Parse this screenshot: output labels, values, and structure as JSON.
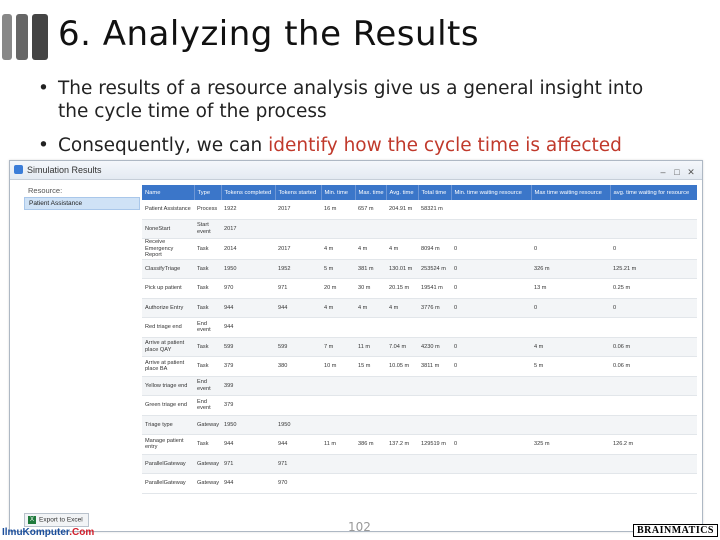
{
  "slide": {
    "title": "6. Analyzing the Results",
    "bullets": [
      {
        "text": "The results of a resource analysis give us a general insight into the cycle time of the process"
      },
      {
        "text_before": "Consequently, we can ",
        "highlight": "identify how the cycle time is affected"
      }
    ],
    "page_number": "102",
    "logo_left": {
      "part1": "IlmuKomputer",
      "part2": ".Com"
    },
    "logo_right": "BRAINMATICS",
    "highlight_color": "#c0392b",
    "title_bar_color": "#555555"
  },
  "window": {
    "title": "Simulation Results",
    "buttons": {
      "minimize": "–",
      "maximize": "□",
      "close": "✕"
    },
    "sidebar": {
      "label": "Resource:",
      "items": [
        "Patient Assistance"
      ]
    },
    "export_button": "Export to Excel",
    "header_color": "#3b76c9",
    "table": {
      "headers": [
        "Name",
        "Type",
        "Tokens completed",
        "Tokens started",
        "Min. time",
        "Max. time",
        "Avg. time",
        "Total time",
        "Min. time waiting resource",
        "Max time waiting resource",
        "avg. time waiting for resource"
      ],
      "rows": [
        [
          "Patient Assistance",
          "Process",
          "1922",
          "2017",
          "16 m",
          "657 m",
          "204.91 m",
          "58321 m",
          "",
          "",
          ""
        ],
        [
          "NoneStart",
          "Start event",
          "2017",
          "",
          "",
          "",
          "",
          "",
          "",
          "",
          ""
        ],
        [
          "Receive Emergency Report",
          "Task",
          "2014",
          "2017",
          "4 m",
          "4 m",
          "4 m",
          "8094 m",
          "0",
          "0",
          "0"
        ],
        [
          "ClassifyTriage",
          "Task",
          "1950",
          "1952",
          "5 m",
          "381 m",
          "130.01 m",
          "253524 m",
          "0",
          "326 m",
          "125.21 m"
        ],
        [
          "Pick up patient",
          "Task",
          "970",
          "971",
          "20 m",
          "30 m",
          "20.15 m",
          "19541 m",
          "0",
          "13 m",
          "0.25 m"
        ],
        [
          "Authorize Entry",
          "Task",
          "944",
          "944",
          "4 m",
          "4 m",
          "4 m",
          "3776 m",
          "0",
          "0",
          "0"
        ],
        [
          "Red triage end",
          "End event",
          "944",
          "",
          "",
          "",
          "",
          "",
          "",
          "",
          ""
        ],
        [
          "Arrive at patient place QAY",
          "Task",
          "599",
          "599",
          "7 m",
          "11 m",
          "7.04 m",
          "4230 m",
          "0",
          "4 m",
          "0.06 m"
        ],
        [
          "Arrive at patient place BA",
          "Task",
          "379",
          "380",
          "10 m",
          "15 m",
          "10.05 m",
          "3811 m",
          "0",
          "5 m",
          "0.06 m"
        ],
        [
          "Yellow triage end",
          "End event",
          "399",
          "",
          "",
          "",
          "",
          "",
          "",
          "",
          ""
        ],
        [
          "Green triage end",
          "End event",
          "379",
          "",
          "",
          "",
          "",
          "",
          "",
          "",
          ""
        ],
        [
          "Triage type",
          "Gateway",
          "1950",
          "1950",
          "",
          "",
          "",
          "",
          "",
          "",
          ""
        ],
        [
          "Manage patient entry",
          "Task",
          "944",
          "944",
          "11 m",
          "386 m",
          "137.2 m",
          "129519 m",
          "0",
          "325 m",
          "126.2 m"
        ],
        [
          "ParallelGateway",
          "Gateway",
          "971",
          "971",
          "",
          "",
          "",
          "",
          "",
          "",
          ""
        ],
        [
          "ParallelGateway",
          "Gateway",
          "944",
          "970",
          "",
          "",
          "",
          "",
          "",
          "",
          ""
        ]
      ]
    }
  }
}
